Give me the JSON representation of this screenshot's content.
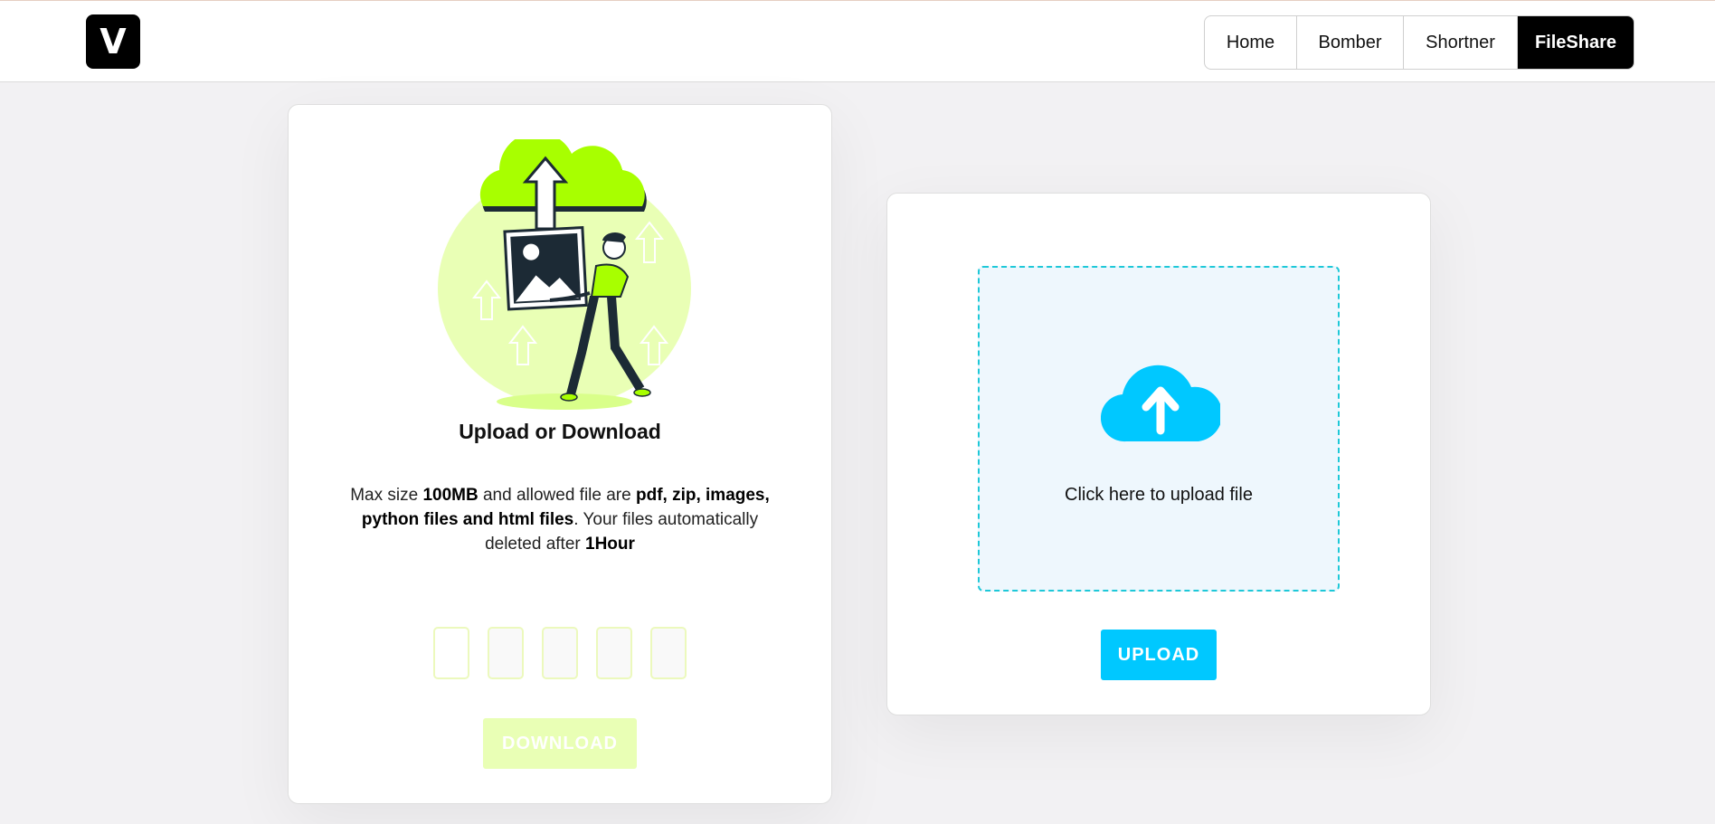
{
  "header": {
    "logo_text": "V",
    "nav": [
      "Home",
      "Bomber",
      "Shortner",
      "FileShare"
    ],
    "active_nav": "FileShare"
  },
  "left_card": {
    "illustration_icon": "person-carrying-image-upload-illustration",
    "title": "Upload or Download",
    "description": {
      "t1": "Max size ",
      "b1": "100MB",
      "t2": " and allowed file are ",
      "b2": "pdf, zip, images, python files and html files",
      "t3": ". Your files automatically deleted after ",
      "b3": "1Hour"
    },
    "code_boxes": [
      "",
      "",
      "",
      "",
      ""
    ],
    "download_label": "DOWNLOAD"
  },
  "right_card": {
    "cloud_icon": "cloud-upload-icon",
    "dropzone_label": "Click here to upload file",
    "upload_label": "UPLOAD"
  },
  "colors": {
    "accent_green": "#a8ff00",
    "accent_cyan": "#00c8ff",
    "nav_active_bg": "#000000"
  }
}
